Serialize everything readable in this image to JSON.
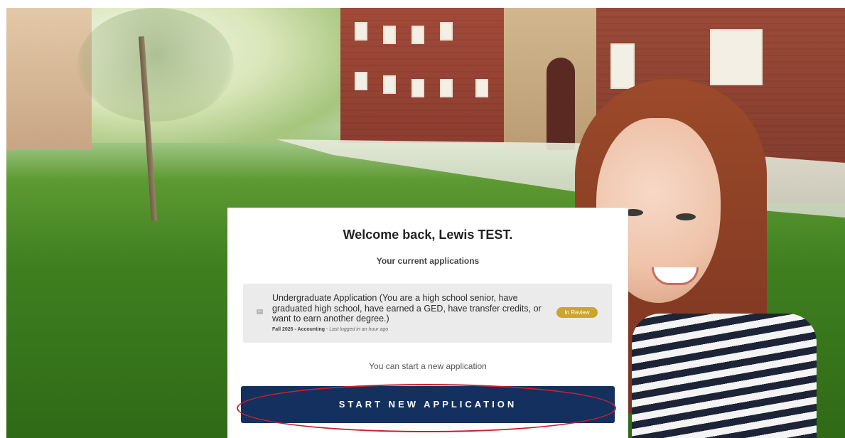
{
  "card": {
    "welcome": "Welcome back, Lewis TEST.",
    "subheading": "Your current applications",
    "applications": [
      {
        "title": "Undergraduate  Application (You are a high school senior, have graduated high school, have earned a GED, have transfer credits, or want to earn another degree.)",
        "term_major": "Fall 2026 - Accounting",
        "last_login": "Last logged in an hour ago",
        "status": "In Review",
        "icon": "document-icon"
      }
    ],
    "new_application_text": "You can start a new application",
    "start_button_label": "START NEW APPLICATION"
  },
  "colors": {
    "primary_button": "#13305e",
    "status_badge": "#c9a62c",
    "annotation": "#cc2030"
  }
}
